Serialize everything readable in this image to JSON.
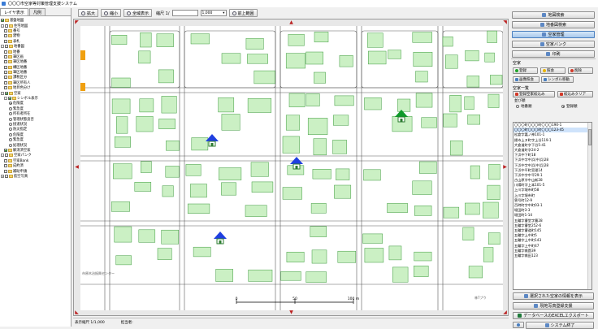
{
  "title": "〇〇〇市空家等対策管理支援システム",
  "left": {
    "tabs": [
      "レイヤ表示",
      "凡例"
    ],
    "tree": [
      {
        "label": "基盤地図",
        "level": 0,
        "toggle": "",
        "check": true
      },
      {
        "label": "住宅地図",
        "level": 0,
        "toggle": "-",
        "check": false
      },
      {
        "label": "番号",
        "level": 1,
        "toggle": "",
        "check": false
      },
      {
        "label": "建物",
        "level": 1,
        "toggle": "",
        "check": false
      },
      {
        "label": "表札",
        "level": 1,
        "toggle": "",
        "check": false
      },
      {
        "label": "地番図",
        "level": 0,
        "toggle": "-",
        "check": false
      },
      {
        "label": "地番",
        "level": 1,
        "toggle": "",
        "check": false
      },
      {
        "label": "筆区画",
        "level": 1,
        "toggle": "",
        "check": false
      },
      {
        "label": "筆区地番",
        "level": 1,
        "toggle": "",
        "check": false
      },
      {
        "label": "構区地番",
        "level": 1,
        "toggle": "",
        "check": false
      },
      {
        "label": "筆区地番",
        "level": 1,
        "toggle": "",
        "check": false
      },
      {
        "label": "課税区分",
        "level": 1,
        "toggle": "",
        "check": false
      },
      {
        "label": "筆区所有人",
        "level": 1,
        "toggle": "",
        "check": false
      },
      {
        "label": "地目色分け",
        "level": 1,
        "toggle": "",
        "check": false
      },
      {
        "label": "空家",
        "level": 0,
        "toggle": "-",
        "check": true
      },
      {
        "label": "シンボル表示",
        "level": 1,
        "toggle": "-",
        "check": true
      },
      {
        "label": "危険度",
        "level": 2,
        "toggle": "",
        "radio": true
      },
      {
        "label": "緊急度",
        "level": 2,
        "toggle": "",
        "radio": false
      },
      {
        "label": "所有者所在",
        "level": 2,
        "toggle": "",
        "radio": false
      },
      {
        "label": "管理状態良否",
        "level": 2,
        "toggle": "",
        "radio": false
      },
      {
        "label": "接道状況",
        "level": 2,
        "toggle": "",
        "radio": false
      },
      {
        "label": "防災指定",
        "level": 2,
        "toggle": "",
        "radio": false
      },
      {
        "label": "危険度",
        "level": 2,
        "toggle": "",
        "radio": false
      },
      {
        "label": "緊急度",
        "level": 2,
        "toggle": "",
        "radio": false
      },
      {
        "label": "処理状況",
        "level": 2,
        "toggle": "",
        "radio": false
      },
      {
        "label": "解消済空家",
        "level": 1,
        "toggle": "",
        "check": true
      },
      {
        "label": "空家パンク",
        "level": 0,
        "toggle": "-",
        "check": false
      },
      {
        "label": "空家Bank",
        "level": 1,
        "toggle": "",
        "check": false
      },
      {
        "label": "成約済",
        "level": 1,
        "toggle": "",
        "check": false
      },
      {
        "label": "補助申請",
        "level": 1,
        "toggle": "",
        "check": false
      },
      {
        "label": "航空写真",
        "level": 0,
        "toggle": "+",
        "check": false
      }
    ]
  },
  "toolbar": {
    "zoom_in": "拡大",
    "zoom_out": "縮小",
    "full_view": "全域表示",
    "scale_label": "縮尺 1/",
    "scale_value": "1,000",
    "prev_extent": "前上範囲"
  },
  "map": {
    "scale_labels": [
      "0",
      "50",
      "100 m"
    ],
    "marker_colors": {
      "blue": "#1f3fe0",
      "green": "#0f9a2a",
      "house": "#2e7d32"
    },
    "annotations": [
      "市原木治振興センター",
      "林7ブウ"
    ]
  },
  "status": {
    "scale": "表示縮尺 1/1,000",
    "user": "担当者:"
  },
  "right": {
    "top_buttons": [
      {
        "label": "地図検索",
        "active": false
      },
      {
        "label": "地番図検索",
        "active": false
      },
      {
        "label": "空家管理",
        "active": true
      },
      {
        "label": "空家バンク",
        "active": false
      },
      {
        "label": "印刷",
        "active": false
      }
    ],
    "group_title": "空家",
    "actions": [
      {
        "label": "登録",
        "color": "#1ea52a"
      },
      {
        "label": "照会",
        "color": "#e9b400"
      },
      {
        "label": "削除",
        "color": "#d23a2a"
      }
    ],
    "btn_image_query": "画像照会",
    "btn_symbol_move": "シンボル移動",
    "list_title": "空家一覧",
    "btn_filter_vacant": "登録空家絞込み",
    "btn_filter_clear": "絞込みクリア",
    "sort_label": "並び順",
    "sort_options": [
      {
        "label": "地番順",
        "selected": false
      },
      {
        "label": "登録順",
        "selected": true
      }
    ],
    "list": [
      "〇〇〇町〇〇〇町〇〇〇190-1",
      "〇〇〇町〇〇〇町〇〇〇123-45",
      "松倉字嘉ノ神101-1",
      "揚寺上ヌ町字上谷119-1",
      "大倉道町字下谷5-41",
      "大倉道町字24-2",
      "下浜中下町18",
      "下浜中字中浜(中浜)28",
      "下浜中字中浜(中浜)28",
      "下浜中平町宮理14",
      "下浜中字中平29-1",
      "古山原字中山新28",
      "川陽町字上本101-5",
      "上川字堰市町58",
      "上川字堰市町",
      "曽号町12-9",
      "百時町字中町03-1",
      "堀田町3-3",
      "堀田町1-14",
      "五輪字曹堂字曹28",
      "五輪字曹堂252-6",
      "五輪字曹道町145",
      "五輪字上中町5",
      "五輪字上中町143",
      "五輪字上中町47",
      "五輪字雑園39",
      "五輪字雑田123"
    ],
    "selected_index": 1,
    "btn_export_selected": "選択された空家の情報を表示",
    "btn_survey": "現地写真登録支援",
    "btn_excel": "データベースのEXCELエクスポート",
    "btn_exit": "システム終了"
  }
}
